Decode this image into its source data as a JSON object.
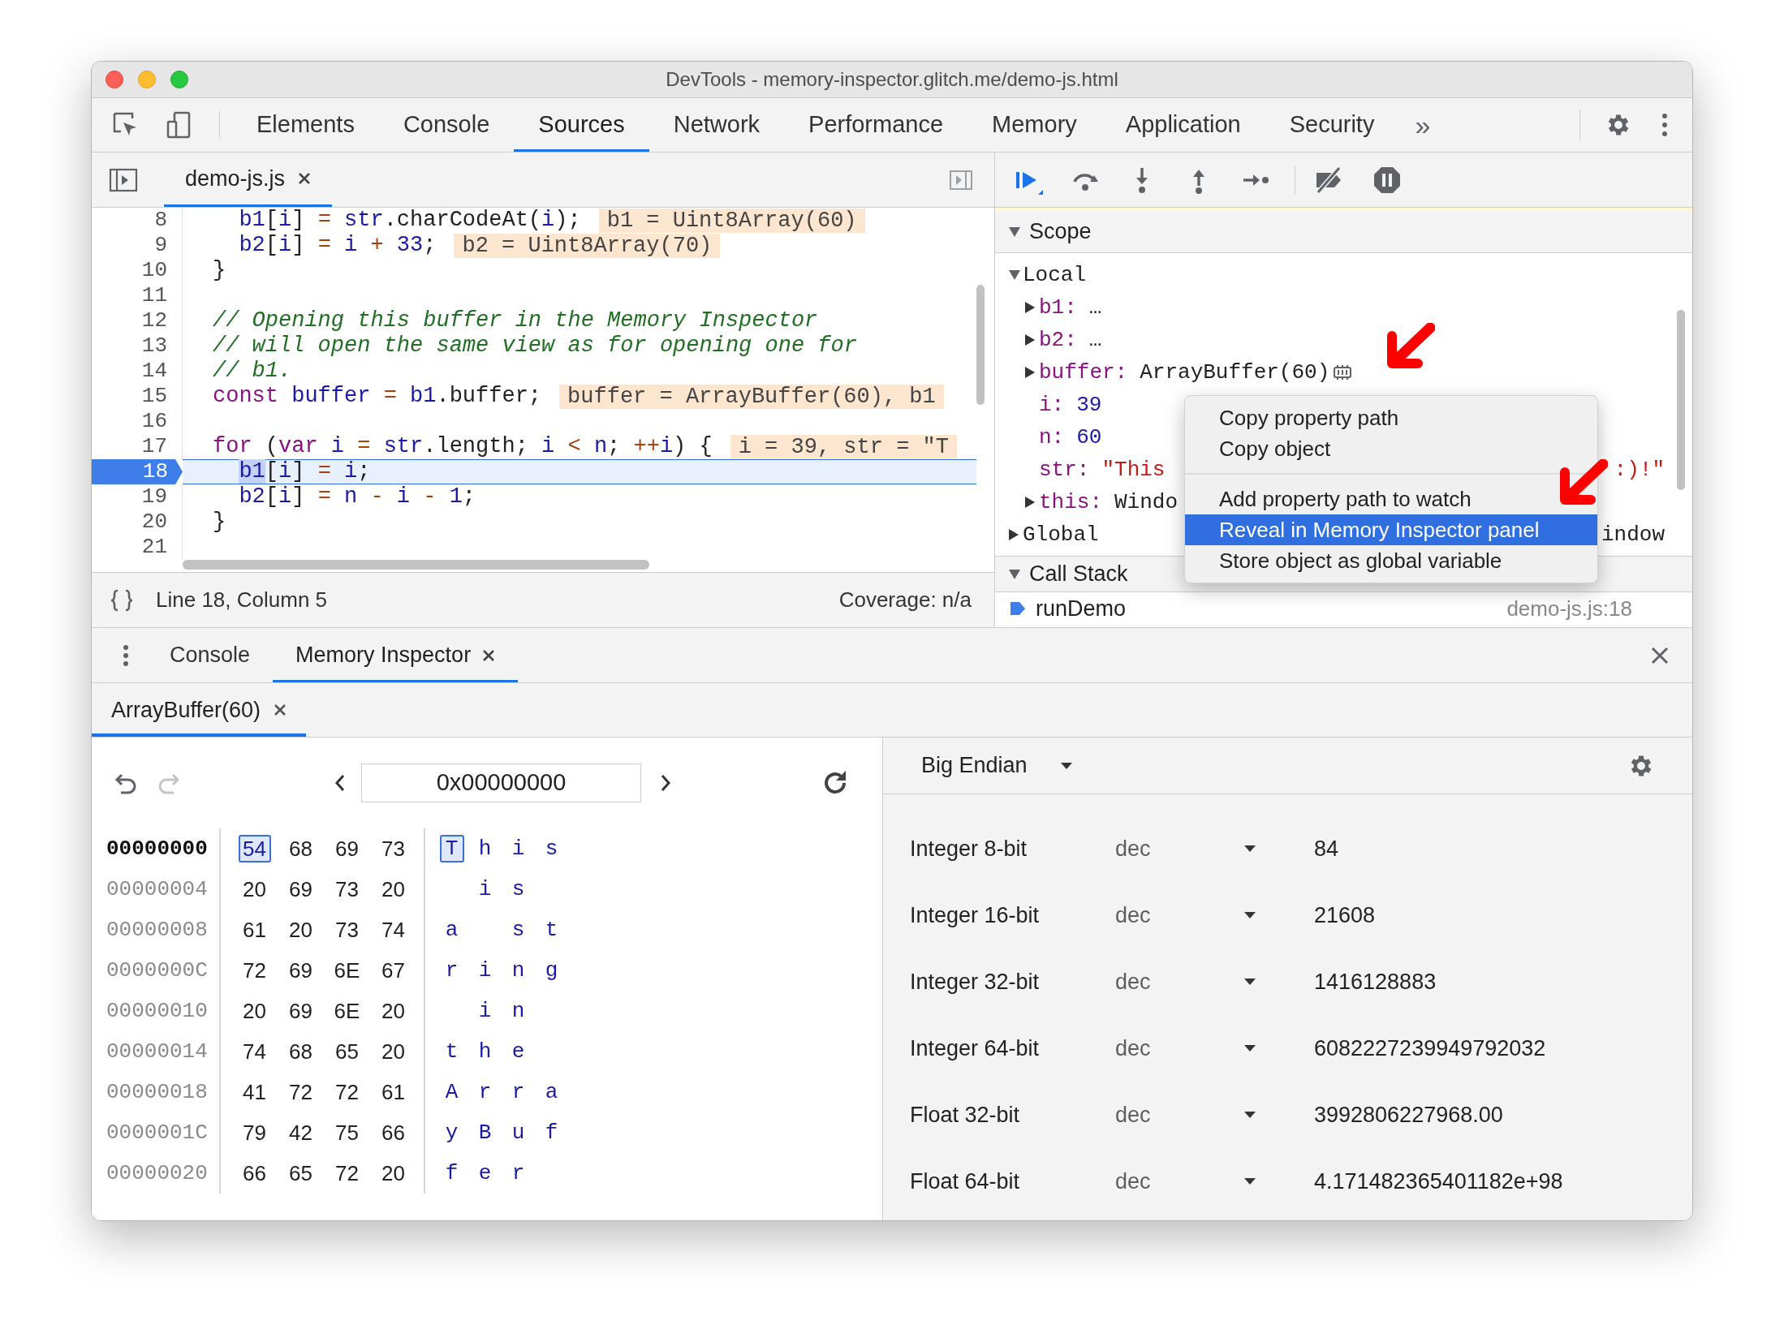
{
  "window": {
    "title": "DevTools - memory-inspector.glitch.me/demo-js.html"
  },
  "main_tabs": [
    {
      "label": "Elements",
      "selected": false
    },
    {
      "label": "Console",
      "selected": false
    },
    {
      "label": "Sources",
      "selected": true
    },
    {
      "label": "Network",
      "selected": false
    },
    {
      "label": "Performance",
      "selected": false
    },
    {
      "label": "Memory",
      "selected": false
    },
    {
      "label": "Application",
      "selected": false
    },
    {
      "label": "Security",
      "selected": false
    }
  ],
  "more_tabs": "»",
  "editor": {
    "file_tab": {
      "label": "demo-js.js",
      "selected": true
    },
    "lines": [
      {
        "number": "8",
        "current": false,
        "tokens": [
          {
            "kind": "id",
            "text": "  b1"
          },
          {
            "kind": "pt",
            "text": "["
          },
          {
            "kind": "id",
            "text": "i"
          },
          {
            "kind": "pt",
            "text": "]"
          },
          {
            "kind": "op",
            "text": " = "
          },
          {
            "kind": "id",
            "text": "str"
          },
          {
            "kind": "pt",
            "text": ".charCodeAt("
          },
          {
            "kind": "id",
            "text": "i"
          },
          {
            "kind": "pt",
            "text": ");"
          }
        ],
        "inline_value": "b1 = Uint8Array(60)"
      },
      {
        "number": "9",
        "current": false,
        "tokens": [
          {
            "kind": "id",
            "text": "  b2"
          },
          {
            "kind": "pt",
            "text": "["
          },
          {
            "kind": "id",
            "text": "i"
          },
          {
            "kind": "pt",
            "text": "]"
          },
          {
            "kind": "op",
            "text": " = "
          },
          {
            "kind": "id",
            "text": "i"
          },
          {
            "kind": "op",
            "text": " + "
          },
          {
            "kind": "num",
            "text": "33"
          },
          {
            "kind": "pt",
            "text": ";"
          }
        ],
        "inline_value": "b2 = Uint8Array(70)"
      },
      {
        "number": "10",
        "current": false,
        "tokens": [
          {
            "kind": "pt",
            "text": "}"
          }
        ]
      },
      {
        "number": "11",
        "current": false
      },
      {
        "number": "12",
        "current": false,
        "tokens": [
          {
            "kind": "cm",
            "text": "// Opening this buffer in the Memory Inspector"
          }
        ]
      },
      {
        "number": "13",
        "current": false,
        "tokens": [
          {
            "kind": "cm",
            "text": "// will open the same view as for opening one for"
          }
        ]
      },
      {
        "number": "14",
        "current": false,
        "tokens": [
          {
            "kind": "cm",
            "text": "// b1."
          }
        ]
      },
      {
        "number": "15",
        "current": false,
        "tokens": [
          {
            "kind": "kw",
            "text": "const"
          },
          {
            "kind": "id",
            "text": " buffer"
          },
          {
            "kind": "op",
            "text": " = "
          },
          {
            "kind": "id",
            "text": "b1"
          },
          {
            "kind": "pt",
            "text": ".buffer;"
          }
        ],
        "inline_value": "buffer = ArrayBuffer(60), b1"
      },
      {
        "number": "16",
        "current": false
      },
      {
        "number": "17",
        "current": false,
        "tokens": [
          {
            "kind": "kw",
            "text": "for"
          },
          {
            "kind": "pt",
            "text": " ("
          },
          {
            "kind": "kw",
            "text": "var"
          },
          {
            "kind": "id",
            "text": " i"
          },
          {
            "kind": "op",
            "text": " = "
          },
          {
            "kind": "id",
            "text": "str"
          },
          {
            "kind": "pt",
            "text": ".length;"
          },
          {
            "kind": "id",
            "text": " i"
          },
          {
            "kind": "op",
            "text": " < "
          },
          {
            "kind": "id",
            "text": "n"
          },
          {
            "kind": "pt",
            "text": "; "
          },
          {
            "kind": "op",
            "text": "++"
          },
          {
            "kind": "id",
            "text": "i"
          },
          {
            "kind": "pt",
            "text": ") {"
          }
        ],
        "inline_value": "i = 39, str = \"T"
      },
      {
        "number": "18",
        "current": true,
        "tokens": [
          {
            "kind": "sel",
            "text": "  b1"
          },
          {
            "kind": "pt",
            "text": "["
          },
          {
            "kind": "id",
            "text": "i"
          },
          {
            "kind": "pt",
            "text": "]"
          },
          {
            "kind": "op",
            "text": " = "
          },
          {
            "kind": "id",
            "text": "i"
          },
          {
            "kind": "pt",
            "text": ";"
          }
        ]
      },
      {
        "number": "19",
        "current": false,
        "tokens": [
          {
            "kind": "id",
            "text": "  b2"
          },
          {
            "kind": "pt",
            "text": "["
          },
          {
            "kind": "id",
            "text": "i"
          },
          {
            "kind": "pt",
            "text": "]"
          },
          {
            "kind": "op",
            "text": " = "
          },
          {
            "kind": "id",
            "text": "n"
          },
          {
            "kind": "op",
            "text": " - "
          },
          {
            "kind": "id",
            "text": "i"
          },
          {
            "kind": "op",
            "text": " - "
          },
          {
            "kind": "num",
            "text": "1"
          },
          {
            "kind": "pt",
            "text": ";"
          }
        ]
      },
      {
        "number": "20",
        "current": false,
        "tokens": [
          {
            "kind": "pt",
            "text": "}"
          }
        ]
      },
      {
        "number": "21",
        "current": false
      }
    ],
    "status": {
      "position": "Line 18, Column 5",
      "coverage": "Coverage: n/a"
    }
  },
  "scope": {
    "title": "Scope",
    "expanded": true,
    "sections": [
      {
        "label": "Local",
        "expanded": true,
        "children": [
          {
            "name": "b1:",
            "value": "…",
            "kind": "plain",
            "expanded": false,
            "memory_icon": false
          },
          {
            "name": "b2:",
            "value": "…",
            "kind": "plain",
            "expanded": false,
            "memory_icon": false
          },
          {
            "name": "buffer:",
            "value": "ArrayBuffer(60)",
            "kind": "plain",
            "expanded": false,
            "memory_icon": true
          },
          {
            "name": "i:",
            "value": "39",
            "kind": "number",
            "memory_icon": false
          },
          {
            "name": "n:",
            "value": "60",
            "kind": "number",
            "memory_icon": false
          },
          {
            "name": "str:",
            "value": "\"This",
            "value_tail": ":)!\"",
            "kind": "string",
            "memory_icon": false
          },
          {
            "name": "this:",
            "value": "Windo",
            "kind": "plain",
            "expanded": false,
            "memory_icon": false
          }
        ]
      },
      {
        "label": "Global",
        "expanded": false,
        "value_tail": "indow"
      }
    ]
  },
  "call_stack": {
    "title": "Call Stack",
    "expanded": true,
    "frames": [
      {
        "name": "runDemo",
        "location": "demo-js.js:18",
        "selected": true
      }
    ]
  },
  "context_menu": {
    "groups": [
      [
        {
          "label": "Copy property path",
          "selected": false
        },
        {
          "label": "Copy object",
          "selected": false
        }
      ],
      [
        {
          "label": "Add property path to watch",
          "selected": false
        },
        {
          "label": "Reveal in Memory Inspector panel",
          "selected": true
        },
        {
          "label": "Store object as global variable",
          "selected": false
        }
      ]
    ]
  },
  "annotations": [
    {
      "kind": "arrow"
    },
    {
      "kind": "arrow"
    }
  ],
  "drawer": {
    "tabs": [
      {
        "label": "Console",
        "selected": false,
        "closable": false
      },
      {
        "label": "Memory Inspector",
        "selected": true,
        "closable": true
      }
    ]
  },
  "memory_inspector": {
    "buffer_tabs": [
      {
        "label": "ArrayBuffer(60)",
        "selected": true
      }
    ],
    "undo_disabled": false,
    "redo_disabled": true,
    "address": "0x00000000",
    "rows": [
      {
        "address": "00000000",
        "current": true,
        "bytes": [
          {
            "hex": "54",
            "char": "T",
            "selected": true
          },
          {
            "hex": "68",
            "char": "h",
            "selected": false
          },
          {
            "hex": "69",
            "char": "i",
            "selected": false
          },
          {
            "hex": "73",
            "char": "s",
            "selected": false
          }
        ]
      },
      {
        "address": "00000004",
        "current": false,
        "bytes": [
          {
            "hex": "20",
            "selected": false
          },
          {
            "hex": "69",
            "char": "i",
            "selected": false
          },
          {
            "hex": "73",
            "char": "s",
            "selected": false
          },
          {
            "hex": "20",
            "selected": false
          }
        ]
      },
      {
        "address": "00000008",
        "current": false,
        "bytes": [
          {
            "hex": "61",
            "char": "a",
            "selected": false
          },
          {
            "hex": "20",
            "selected": false
          },
          {
            "hex": "73",
            "char": "s",
            "selected": false
          },
          {
            "hex": "74",
            "char": "t",
            "selected": false
          }
        ]
      },
      {
        "address": "0000000C",
        "current": false,
        "bytes": [
          {
            "hex": "72",
            "char": "r",
            "selected": false
          },
          {
            "hex": "69",
            "char": "i",
            "selected": false
          },
          {
            "hex": "6E",
            "char": "n",
            "selected": false
          },
          {
            "hex": "67",
            "char": "g",
            "selected": false
          }
        ]
      },
      {
        "address": "00000010",
        "current": false,
        "bytes": [
          {
            "hex": "20",
            "selected": false
          },
          {
            "hex": "69",
            "char": "i",
            "selected": false
          },
          {
            "hex": "6E",
            "char": "n",
            "selected": false
          },
          {
            "hex": "20",
            "selected": false
          }
        ]
      },
      {
        "address": "00000014",
        "current": false,
        "bytes": [
          {
            "hex": "74",
            "char": "t",
            "selected": false
          },
          {
            "hex": "68",
            "char": "h",
            "selected": false
          },
          {
            "hex": "65",
            "char": "e",
            "selected": false
          },
          {
            "hex": "20",
            "selected": false
          }
        ]
      },
      {
        "address": "00000018",
        "current": false,
        "bytes": [
          {
            "hex": "41",
            "char": "A",
            "selected": false
          },
          {
            "hex": "72",
            "char": "r",
            "selected": false
          },
          {
            "hex": "72",
            "char": "r",
            "selected": false
          },
          {
            "hex": "61",
            "char": "a",
            "selected": false
          }
        ]
      },
      {
        "address": "0000001C",
        "current": false,
        "bytes": [
          {
            "hex": "79",
            "char": "y",
            "selected": false
          },
          {
            "hex": "42",
            "char": "B",
            "selected": false
          },
          {
            "hex": "75",
            "char": "u",
            "selected": false
          },
          {
            "hex": "66",
            "char": "f",
            "selected": false
          }
        ]
      },
      {
        "address": "00000020",
        "current": false,
        "bytes": [
          {
            "hex": "66",
            "char": "f",
            "selected": false
          },
          {
            "hex": "65",
            "char": "e",
            "selected": false
          },
          {
            "hex": "72",
            "char": "r",
            "selected": false
          },
          {
            "hex": "20",
            "selected": false
          }
        ]
      }
    ],
    "endianness": "Big Endian",
    "values": [
      {
        "label": "Integer 8-bit",
        "format": "dec",
        "value": "84"
      },
      {
        "label": "Integer 16-bit",
        "format": "dec",
        "value": "21608"
      },
      {
        "label": "Integer 32-bit",
        "format": "dec",
        "value": "1416128883"
      },
      {
        "label": "Integer 64-bit",
        "format": "dec",
        "value": "6082227239949792032"
      },
      {
        "label": "Float 32-bit",
        "format": "dec",
        "value": "3992806227968.00"
      },
      {
        "label": "Float 64-bit",
        "format": "dec",
        "value": "4.171482365401182e+98"
      }
    ]
  }
}
